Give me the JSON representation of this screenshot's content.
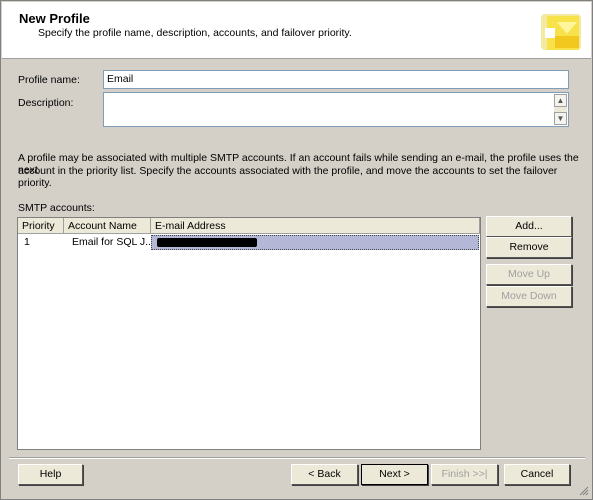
{
  "header": {
    "title": "New Profile",
    "subtitle": "Specify the profile name, description, accounts, and failover priority."
  },
  "form": {
    "profile_name_label": "Profile name:",
    "profile_name_value": "Email",
    "description_label": "Description:",
    "description_value": "",
    "info_line1": "A profile may be associated with multiple SMTP accounts. If an account fails while sending an e-mail, the profile uses the next",
    "info_line2": "account in the priority list. Specify the accounts associated with the profile, and move the accounts to set the failover priority."
  },
  "smtp": {
    "label": "SMTP accounts:",
    "columns": [
      "Priority",
      "Account Name",
      "E-mail Address"
    ],
    "rows": [
      {
        "priority": "1",
        "account_name": "Email for SQL J...",
        "email": ""
      }
    ]
  },
  "side_buttons": {
    "add": "Add...",
    "remove": "Remove",
    "move_up": "Move Up",
    "move_down": "Move Down"
  },
  "footer": {
    "help": "Help",
    "back": "< Back",
    "next": "Next >",
    "finish": "Finish >>|",
    "cancel": "Cancel"
  }
}
